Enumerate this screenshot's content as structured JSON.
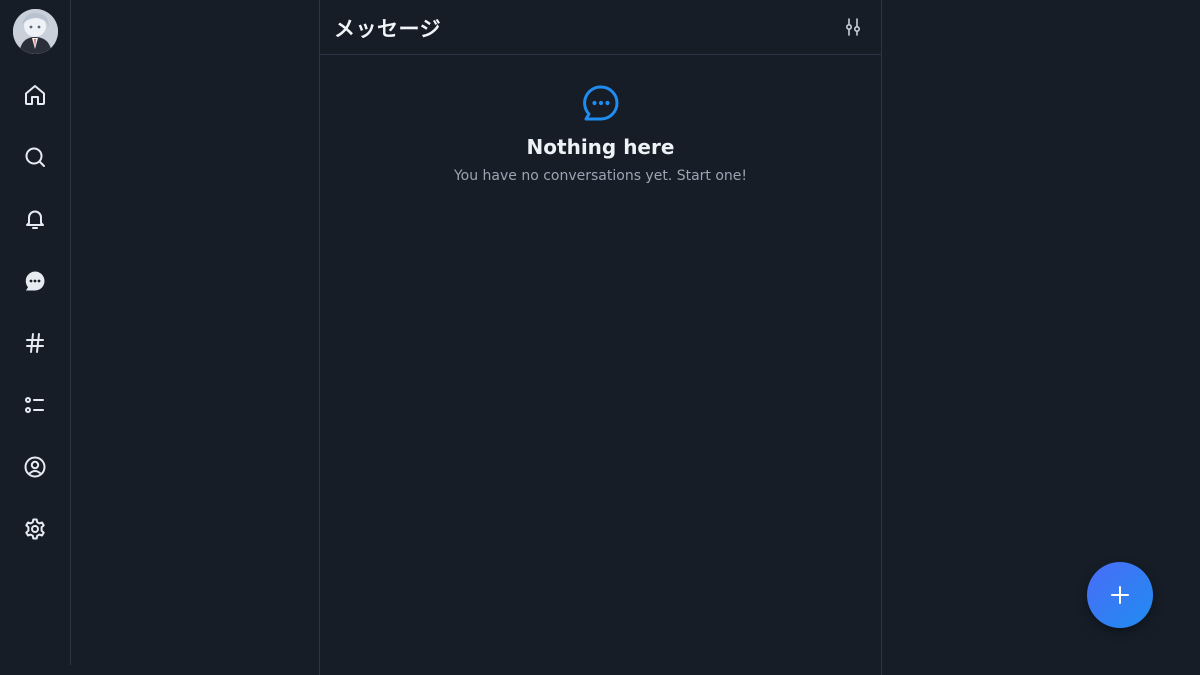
{
  "sidebar": {
    "items": [
      {
        "name": "home",
        "icon": "home-icon"
      },
      {
        "name": "search",
        "icon": "search-icon"
      },
      {
        "name": "notifications",
        "icon": "bell-icon"
      },
      {
        "name": "messages",
        "icon": "chat-bubble-icon"
      },
      {
        "name": "feeds",
        "icon": "hashtag-icon"
      },
      {
        "name": "lists",
        "icon": "list-icon"
      },
      {
        "name": "profile",
        "icon": "user-circle-icon"
      },
      {
        "name": "settings",
        "icon": "gear-icon"
      }
    ]
  },
  "header": {
    "title": "メッセージ",
    "filter_icon": "sliders-icon"
  },
  "empty_state": {
    "icon": "chat-bubble-ellipsis-icon",
    "title": "Nothing here",
    "subtitle": "You have no conversations yet. Start one!"
  },
  "fab": {
    "icon": "plus-icon"
  },
  "colors": {
    "background": "#161d27",
    "accent": "#1f8cf0",
    "border": "#2a3645"
  }
}
